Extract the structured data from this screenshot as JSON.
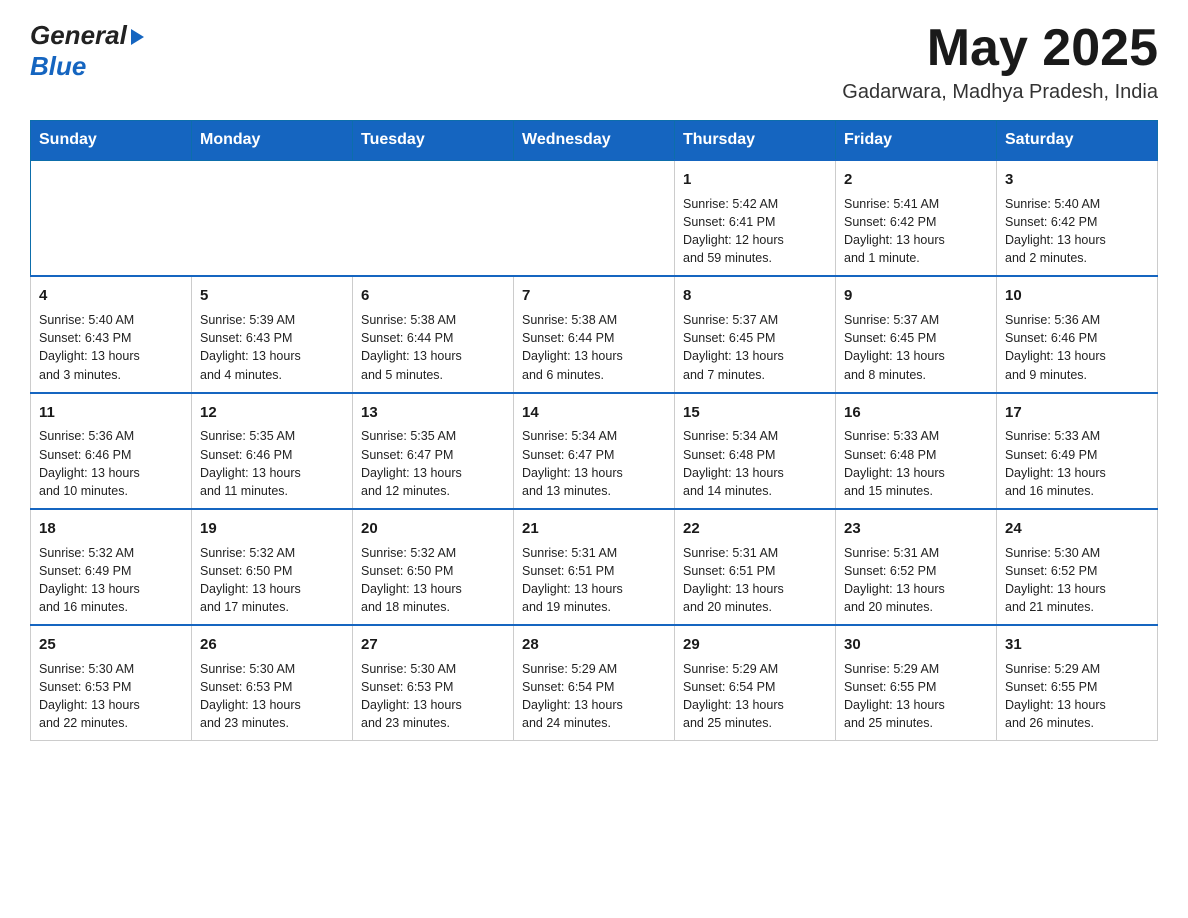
{
  "logo": {
    "line1": "General",
    "line2": "Blue"
  },
  "title": {
    "month": "May 2025",
    "location": "Gadarwara, Madhya Pradesh, India"
  },
  "weekdays": [
    "Sunday",
    "Monday",
    "Tuesday",
    "Wednesday",
    "Thursday",
    "Friday",
    "Saturday"
  ],
  "weeks": [
    [
      {
        "day": "",
        "info": ""
      },
      {
        "day": "",
        "info": ""
      },
      {
        "day": "",
        "info": ""
      },
      {
        "day": "",
        "info": ""
      },
      {
        "day": "1",
        "info": "Sunrise: 5:42 AM\nSunset: 6:41 PM\nDaylight: 12 hours\nand 59 minutes."
      },
      {
        "day": "2",
        "info": "Sunrise: 5:41 AM\nSunset: 6:42 PM\nDaylight: 13 hours\nand 1 minute."
      },
      {
        "day": "3",
        "info": "Sunrise: 5:40 AM\nSunset: 6:42 PM\nDaylight: 13 hours\nand 2 minutes."
      }
    ],
    [
      {
        "day": "4",
        "info": "Sunrise: 5:40 AM\nSunset: 6:43 PM\nDaylight: 13 hours\nand 3 minutes."
      },
      {
        "day": "5",
        "info": "Sunrise: 5:39 AM\nSunset: 6:43 PM\nDaylight: 13 hours\nand 4 minutes."
      },
      {
        "day": "6",
        "info": "Sunrise: 5:38 AM\nSunset: 6:44 PM\nDaylight: 13 hours\nand 5 minutes."
      },
      {
        "day": "7",
        "info": "Sunrise: 5:38 AM\nSunset: 6:44 PM\nDaylight: 13 hours\nand 6 minutes."
      },
      {
        "day": "8",
        "info": "Sunrise: 5:37 AM\nSunset: 6:45 PM\nDaylight: 13 hours\nand 7 minutes."
      },
      {
        "day": "9",
        "info": "Sunrise: 5:37 AM\nSunset: 6:45 PM\nDaylight: 13 hours\nand 8 minutes."
      },
      {
        "day": "10",
        "info": "Sunrise: 5:36 AM\nSunset: 6:46 PM\nDaylight: 13 hours\nand 9 minutes."
      }
    ],
    [
      {
        "day": "11",
        "info": "Sunrise: 5:36 AM\nSunset: 6:46 PM\nDaylight: 13 hours\nand 10 minutes."
      },
      {
        "day": "12",
        "info": "Sunrise: 5:35 AM\nSunset: 6:46 PM\nDaylight: 13 hours\nand 11 minutes."
      },
      {
        "day": "13",
        "info": "Sunrise: 5:35 AM\nSunset: 6:47 PM\nDaylight: 13 hours\nand 12 minutes."
      },
      {
        "day": "14",
        "info": "Sunrise: 5:34 AM\nSunset: 6:47 PM\nDaylight: 13 hours\nand 13 minutes."
      },
      {
        "day": "15",
        "info": "Sunrise: 5:34 AM\nSunset: 6:48 PM\nDaylight: 13 hours\nand 14 minutes."
      },
      {
        "day": "16",
        "info": "Sunrise: 5:33 AM\nSunset: 6:48 PM\nDaylight: 13 hours\nand 15 minutes."
      },
      {
        "day": "17",
        "info": "Sunrise: 5:33 AM\nSunset: 6:49 PM\nDaylight: 13 hours\nand 16 minutes."
      }
    ],
    [
      {
        "day": "18",
        "info": "Sunrise: 5:32 AM\nSunset: 6:49 PM\nDaylight: 13 hours\nand 16 minutes."
      },
      {
        "day": "19",
        "info": "Sunrise: 5:32 AM\nSunset: 6:50 PM\nDaylight: 13 hours\nand 17 minutes."
      },
      {
        "day": "20",
        "info": "Sunrise: 5:32 AM\nSunset: 6:50 PM\nDaylight: 13 hours\nand 18 minutes."
      },
      {
        "day": "21",
        "info": "Sunrise: 5:31 AM\nSunset: 6:51 PM\nDaylight: 13 hours\nand 19 minutes."
      },
      {
        "day": "22",
        "info": "Sunrise: 5:31 AM\nSunset: 6:51 PM\nDaylight: 13 hours\nand 20 minutes."
      },
      {
        "day": "23",
        "info": "Sunrise: 5:31 AM\nSunset: 6:52 PM\nDaylight: 13 hours\nand 20 minutes."
      },
      {
        "day": "24",
        "info": "Sunrise: 5:30 AM\nSunset: 6:52 PM\nDaylight: 13 hours\nand 21 minutes."
      }
    ],
    [
      {
        "day": "25",
        "info": "Sunrise: 5:30 AM\nSunset: 6:53 PM\nDaylight: 13 hours\nand 22 minutes."
      },
      {
        "day": "26",
        "info": "Sunrise: 5:30 AM\nSunset: 6:53 PM\nDaylight: 13 hours\nand 23 minutes."
      },
      {
        "day": "27",
        "info": "Sunrise: 5:30 AM\nSunset: 6:53 PM\nDaylight: 13 hours\nand 23 minutes."
      },
      {
        "day": "28",
        "info": "Sunrise: 5:29 AM\nSunset: 6:54 PM\nDaylight: 13 hours\nand 24 minutes."
      },
      {
        "day": "29",
        "info": "Sunrise: 5:29 AM\nSunset: 6:54 PM\nDaylight: 13 hours\nand 25 minutes."
      },
      {
        "day": "30",
        "info": "Sunrise: 5:29 AM\nSunset: 6:55 PM\nDaylight: 13 hours\nand 25 minutes."
      },
      {
        "day": "31",
        "info": "Sunrise: 5:29 AM\nSunset: 6:55 PM\nDaylight: 13 hours\nand 26 minutes."
      }
    ]
  ]
}
